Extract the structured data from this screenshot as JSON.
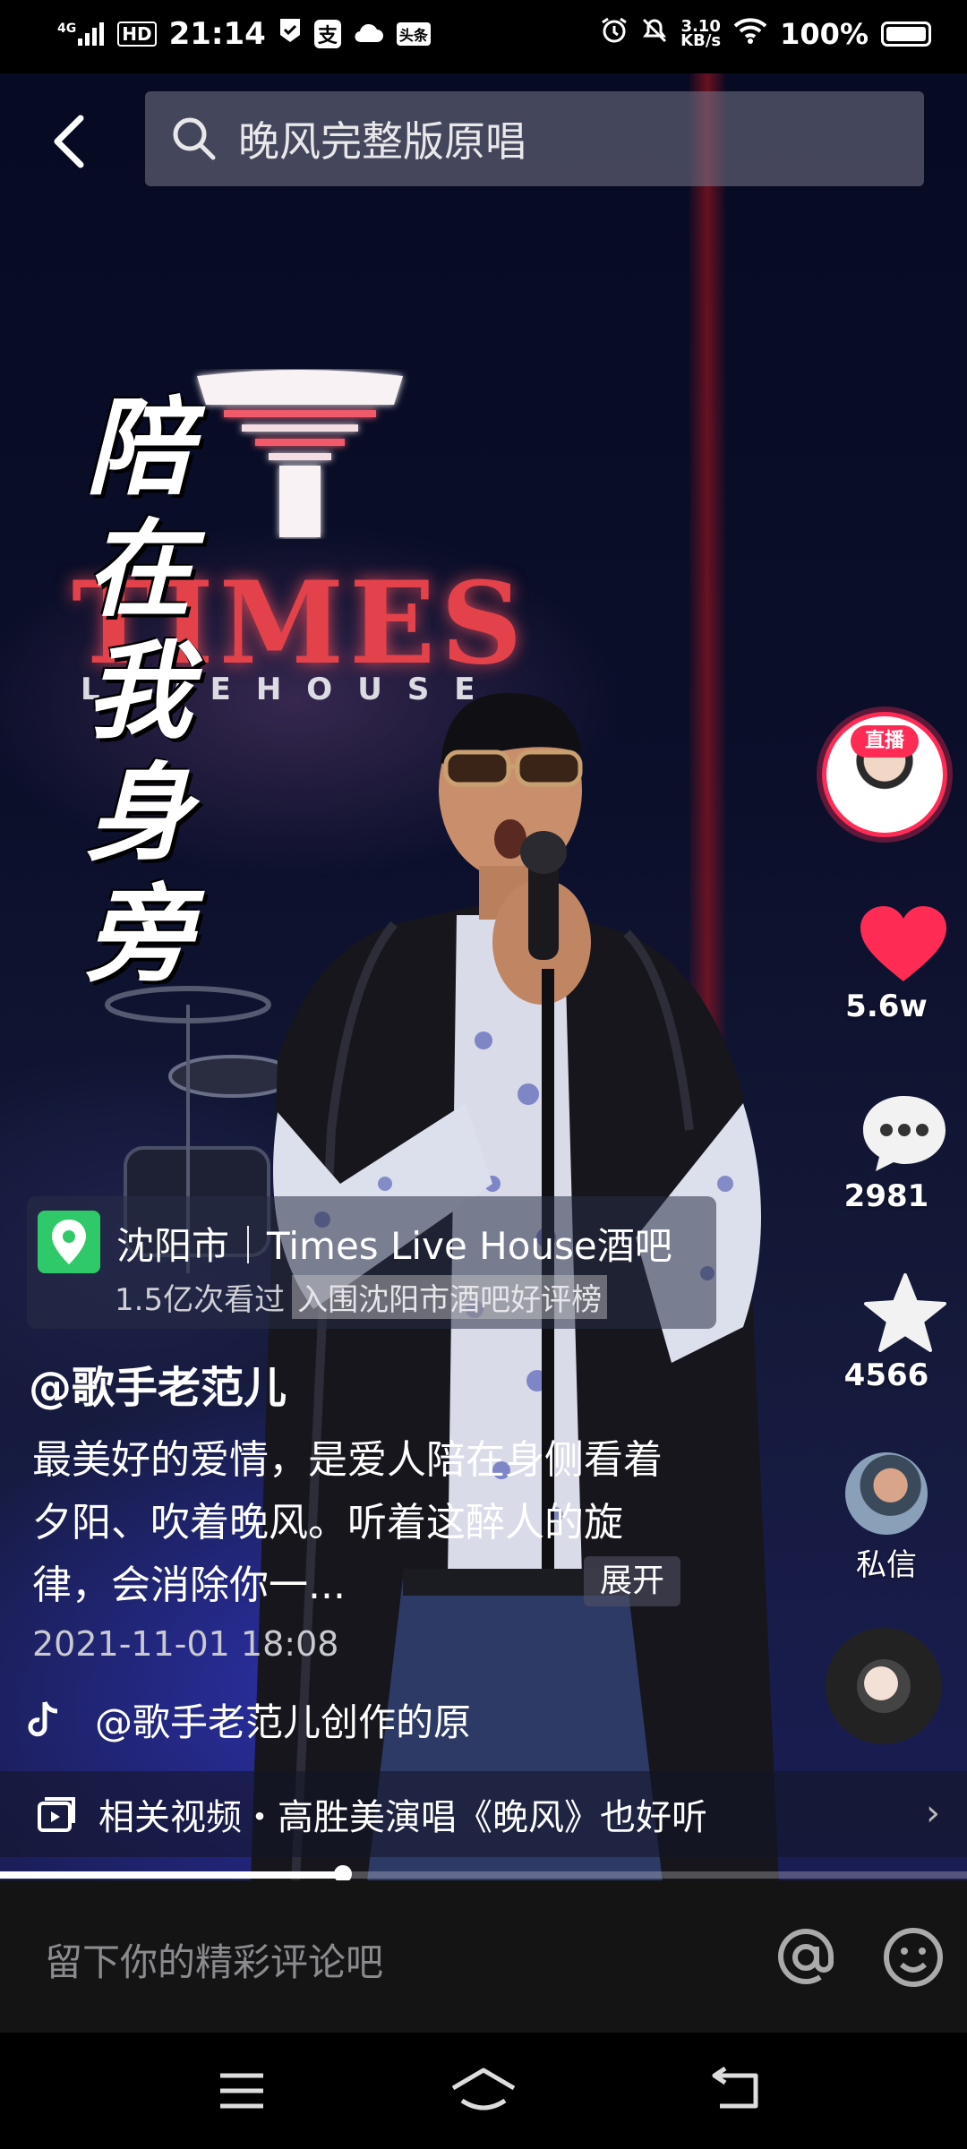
{
  "status_bar": {
    "network": "4G",
    "hd": "HD",
    "time": "21:14",
    "app_icons": [
      "check-shield-icon",
      "alipay-icon",
      "cloud-icon",
      "toutiao-icon"
    ],
    "toutiao_label": "头条",
    "alipay_label": "支",
    "speed_value": "3.10",
    "speed_unit": "KB/s",
    "battery": "100%"
  },
  "search": {
    "query": "晚风完整版原唱"
  },
  "video_overlay": {
    "vertical_text": "陪在我身旁",
    "logo_text": "TIMES",
    "logo_subtext": "LIVEHOUSE"
  },
  "side_actions": {
    "live_badge": "直播",
    "likes": "5.6w",
    "comments": "2981",
    "favorites": "4566",
    "dm_label": "私信"
  },
  "location": {
    "name": "沈阳市｜Times Live House酒吧",
    "views": "1.5亿次看过",
    "rank": "入围沈阳市酒吧好评榜"
  },
  "post": {
    "author": "@歌手老范儿",
    "description": "最美好的爱情，是爱人陪在身侧看着夕阳、吹着晚风。听着这醉人的旋律，会消除你一...",
    "expand_label": "展开",
    "date": "2021-11-01  18:08",
    "music": "@歌手老范儿创作的原"
  },
  "related": {
    "text": "相关视频・高胜美演唱《晚风》也好听"
  },
  "progress": {
    "fraction": 0.355
  },
  "comment_input": {
    "placeholder": "留下你的精彩评论吧"
  },
  "colors": {
    "like": "#fe2c55",
    "location_pin": "#2fc96a",
    "logo_red": "#e3424b"
  }
}
